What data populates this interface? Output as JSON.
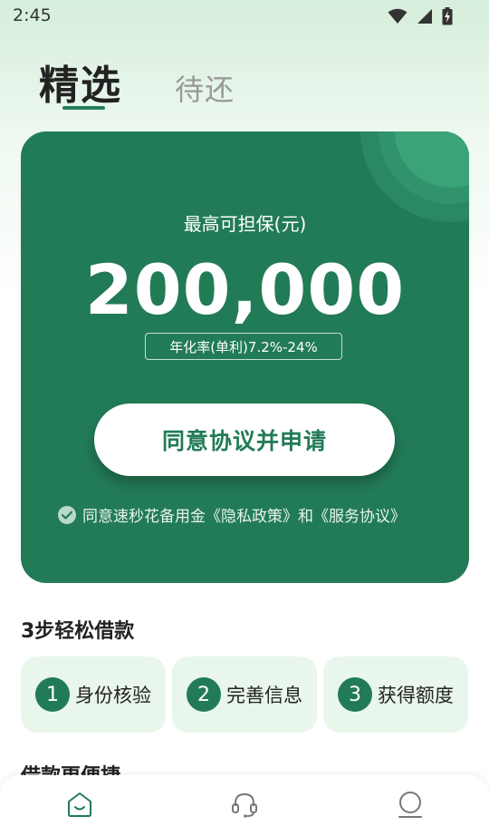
{
  "status_bar": {
    "time": "2:45"
  },
  "tabs": {
    "active": "精选",
    "inactive": "待还"
  },
  "card": {
    "label": "最高可担保(元)",
    "amount": "200,000",
    "rate": "年化率(单利)7.2%-24%",
    "apply_button": "同意协议并申请",
    "agreement": "同意速秒花备用金《隐私政策》和《服务协议》"
  },
  "steps": {
    "title": "3步轻松借款",
    "items": [
      {
        "num": "1",
        "label": "身份核验"
      },
      {
        "num": "2",
        "label": "完善信息"
      },
      {
        "num": "3",
        "label": "获得额度"
      }
    ]
  },
  "next_section_title": "借款更便捷",
  "colors": {
    "brand": "#227b57",
    "step_bg": "#e9f6ec"
  },
  "icons": {
    "home": "home-icon",
    "service": "headset-icon",
    "profile": "profile-icon"
  }
}
